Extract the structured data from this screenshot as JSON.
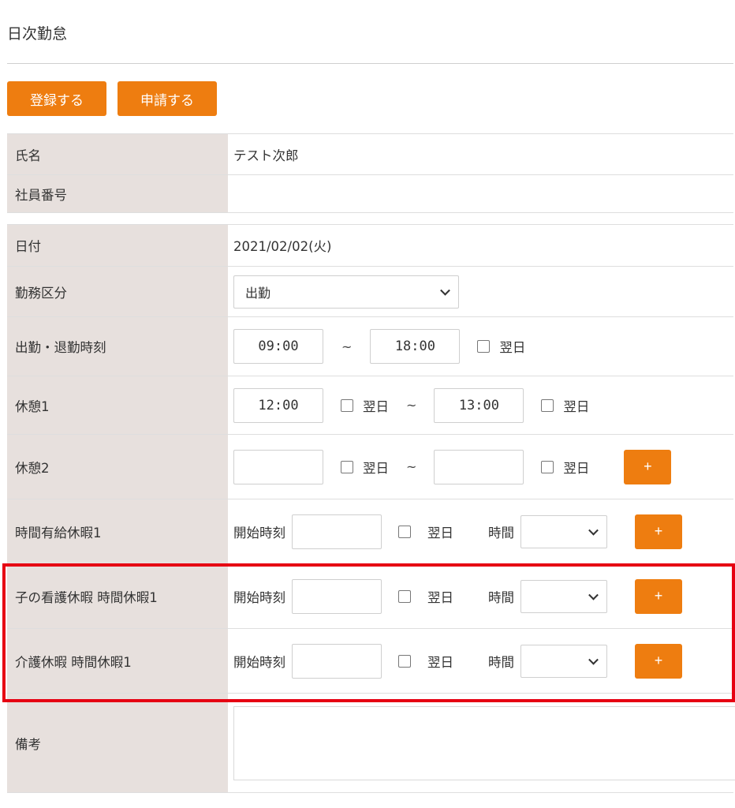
{
  "page": {
    "title": "日次勤怠"
  },
  "toolbar": {
    "register_label": "登録する",
    "apply_label": "申請する"
  },
  "employee": {
    "name_label": "氏名",
    "name_value": "テスト次郎",
    "number_label": "社員番号",
    "number_value": ""
  },
  "attendance": {
    "date_label": "日付",
    "date_value": "2021/02/02(火)",
    "work_type_label": "勤務区分",
    "work_type_value": "出勤",
    "time_label": "出勤・退勤時刻",
    "start_time": "09:00",
    "end_time": "18:00",
    "next_day_label": "翌日",
    "tilde": "~",
    "break1_label": "休憩1",
    "break1_start": "12:00",
    "break1_end": "13:00",
    "break2_label": "休憩2",
    "break2_start": "",
    "break2_end": "",
    "plus_label": "+",
    "start_time_label": "開始時刻",
    "hours_label": "時間",
    "paid_leave_label": "時間有給休暇1",
    "child_care_label": "子の看護休暇 時間休暇1",
    "nursing_care_label": "介護休暇 時間休暇1",
    "remarks_label": "備考"
  },
  "colors": {
    "accent": "#ee7d10",
    "label_bg": "#e7e0dd",
    "highlight": "#e60012"
  }
}
